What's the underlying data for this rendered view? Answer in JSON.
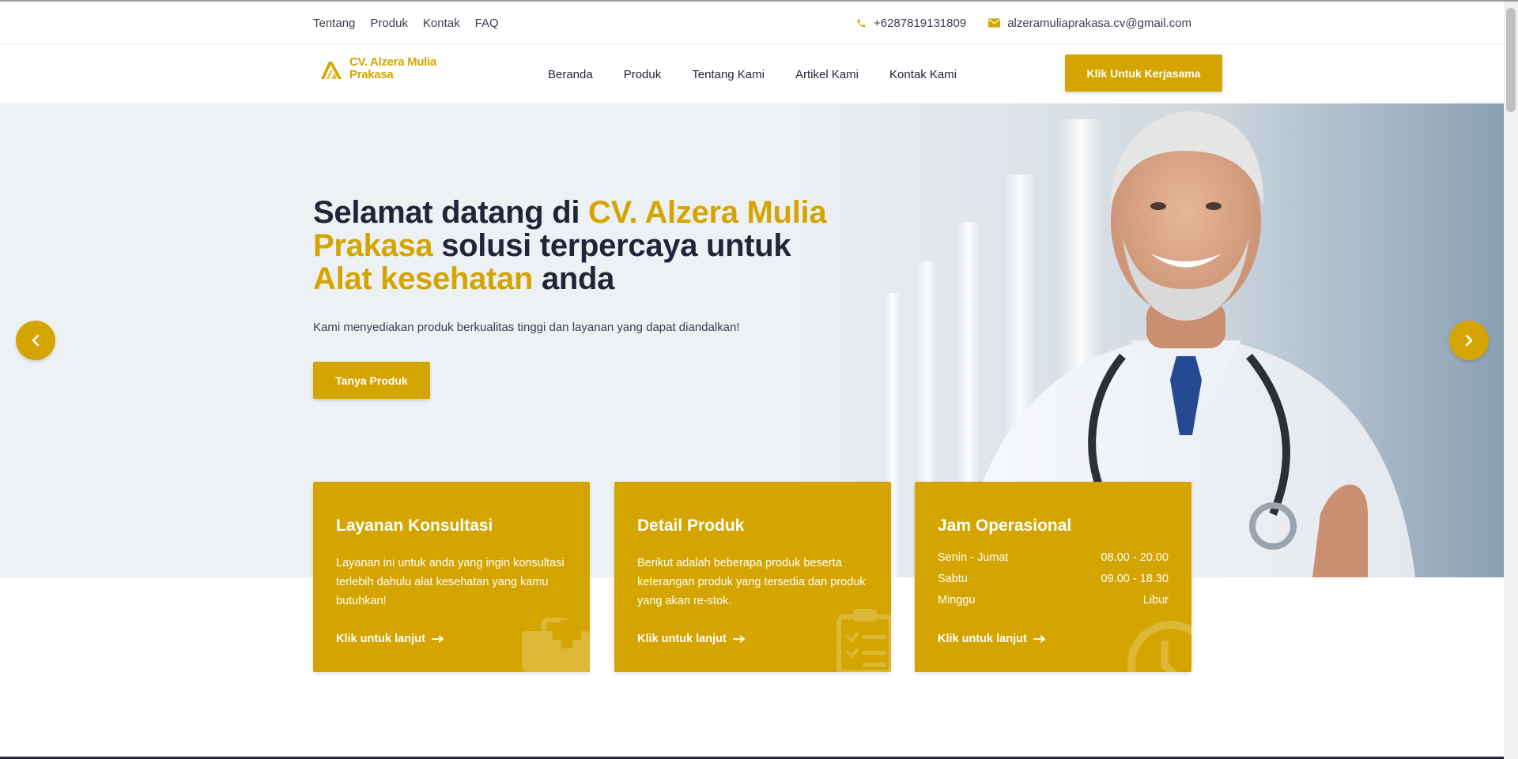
{
  "topbar": {
    "links": [
      "Tentang",
      "Produk",
      "Kontak",
      "FAQ"
    ],
    "phone": "+6287819131809",
    "email": "alzeramuliaprakasa.cv@gmail.com",
    "phone_icon": "phone-icon",
    "email_icon": "envelope-icon"
  },
  "navbar": {
    "logo_line1": "CV. Alzera Mulia",
    "logo_line2": "Prakasa",
    "items": [
      "Beranda",
      "Produk",
      "Tentang Kami",
      "Artikel Kami",
      "Kontak Kami"
    ],
    "cta": "Klik Untuk Kerjasama"
  },
  "hero": {
    "title_1": "Selamat datang di ",
    "title_2": "CV. Alzera Mulia Prakasa",
    "title_3": " solusi terpercaya untuk ",
    "title_4": "Alat kesehatan",
    "title_5": " anda",
    "subtitle": "Kami menyediakan produk berkualitas tinggi dan layanan yang dapat diandalkan!",
    "button": "Tanya Produk",
    "prev_icon": "chevron-left-icon",
    "next_icon": "chevron-right-icon"
  },
  "cards": [
    {
      "title": "Layanan Konsultasi",
      "text": "Layanan ini untuk anda yang ingin konsultasi terlebih dahulu alat kesehatan yang kamu butuhkan!",
      "link": "Klik untuk lanjut",
      "icon": "medical-kit-icon"
    },
    {
      "title": "Detail Produk",
      "text": "Berikut adalah beberapa produk beserta keterangan produk yang tersedia dan produk yang akan re-stok.",
      "link": "Klik untuk lanjut",
      "icon": "clipboard-checklist-icon"
    },
    {
      "title": "Jam Operasional",
      "hours": [
        {
          "day": "Senin - Jumat",
          "time": "08.00 - 20.00"
        },
        {
          "day": "Sabtu",
          "time": "09.00 - 18.30"
        },
        {
          "day": "Minggu",
          "time": "Libur"
        }
      ],
      "link": "Klik untuk lanjut",
      "icon": "clock-icon"
    }
  ],
  "colors": {
    "accent": "#d4a500",
    "text_dark": "#22253a"
  }
}
